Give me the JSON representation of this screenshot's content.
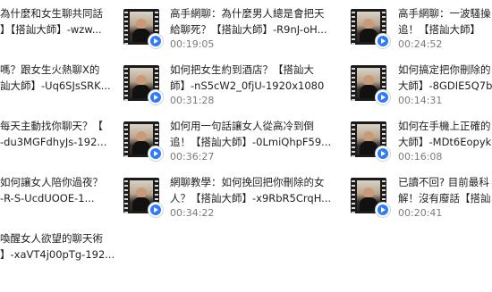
{
  "files": [
    {
      "line1": "為什麼和女生聊共同話",
      "line2": "】【搭訕大師】-wzw...",
      "duration": ""
    },
    {
      "line1": "高手網聊：為什麼男人總是會把天",
      "line2": "給聊死？【搭訕大師】-R9nJ-oH...",
      "duration": "00:19:05"
    },
    {
      "line1": "高手網聊：一波騷操",
      "line2": "追！【搭訕大師】",
      "duration": "00:24:52"
    },
    {
      "line1": "嗎？跟女生火熱聊X的",
      "line2": "訕大師】-Uq6SJsSRK...",
      "duration": ""
    },
    {
      "line1": "如何把女生約到酒店？【搭訕大",
      "line2": "師】-nS5cW2_0fjU-1920x1080",
      "duration": "00:31:28"
    },
    {
      "line1": "如何搞定把你刪除的",
      "line2": "大師】-8GDIE5Q7b",
      "duration": "00:14:31"
    },
    {
      "line1": "每天主動找你聊天？【",
      "line2": "-du3MGFdhyJs-192...",
      "duration": ""
    },
    {
      "line1": "如何用一句話讓女人從高冷到倒",
      "line2": "追！【搭訕大師】-0LmiQhpF59...",
      "duration": "00:36:27"
    },
    {
      "line1": "如何在手機上正確的",
      "line2": "大師】-MDt6Eopyk",
      "duration": "00:16:08"
    },
    {
      "line1": "如何讓女人陪你過夜？",
      "line2": "-R-S-UcdUOOE-1...",
      "duration": ""
    },
    {
      "line1": "網聊教學：如何挽回把你刪除的女",
      "line2": "人？【搭訕大師】-x9RbR5CrqH...",
      "duration": "00:34:22"
    },
    {
      "line1": "已讀不回? 目前最科",
      "line2": "解！沒有廢話【搭訕",
      "duration": "00:20:41"
    },
    {
      "line1": "喚醒女人欲望的聊天術",
      "line2": "】-xaVT4j00pTg-192...",
      "duration": ""
    }
  ]
}
